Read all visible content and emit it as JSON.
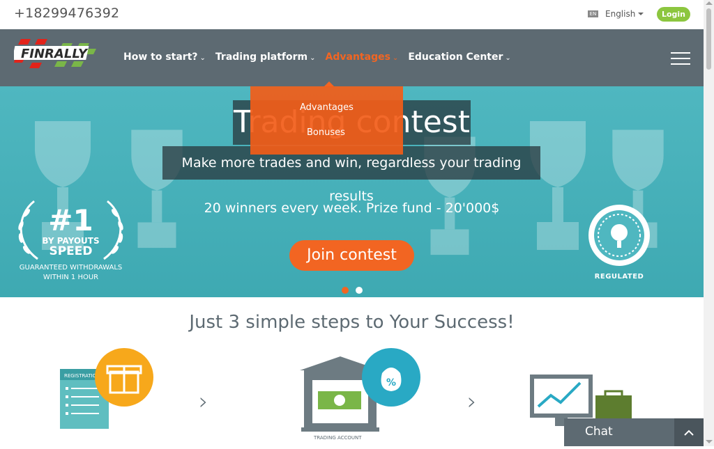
{
  "topbar": {
    "phone": "+18299476392",
    "lang_flag": "EN",
    "lang_label": "English",
    "login_label": "Login"
  },
  "nav": {
    "logo_text": "FINRALLY",
    "items": [
      {
        "label": "How to start?"
      },
      {
        "label": "Trading platform"
      },
      {
        "label": "Advantages"
      },
      {
        "label": "Education Center"
      }
    ],
    "active_color": "#f26522"
  },
  "dropdown": {
    "items": [
      {
        "label": "Advantages"
      },
      {
        "label": "Bonuses"
      }
    ]
  },
  "hero": {
    "title": "Trading contest",
    "subtitle": "Make more trades and win, regardless your trading results",
    "prize": "20 winners every week. Prize fund - 20'000$",
    "cta": "Join contest",
    "badge": {
      "number": "#1",
      "by": "BY PAYOUTS",
      "speed": "SPEED",
      "guarantee1": "GUARANTEED WITHDRAWALS",
      "guarantee2": "WITHIN 1 HOUR"
    },
    "regulated": "REGULATED",
    "slide_count": 2,
    "active_slide": 1
  },
  "steps": {
    "title": "Just 3 simple steps to Your Success!",
    "step1_label": "REGISTRATION",
    "step2_label": "TRADING ACCOUNT"
  },
  "chat": {
    "label": "Chat"
  },
  "colors": {
    "nav_bg": "#5d6a72",
    "accent": "#f26522",
    "login_green": "#8cc63f",
    "hero_teal": "#4fb7c0"
  }
}
